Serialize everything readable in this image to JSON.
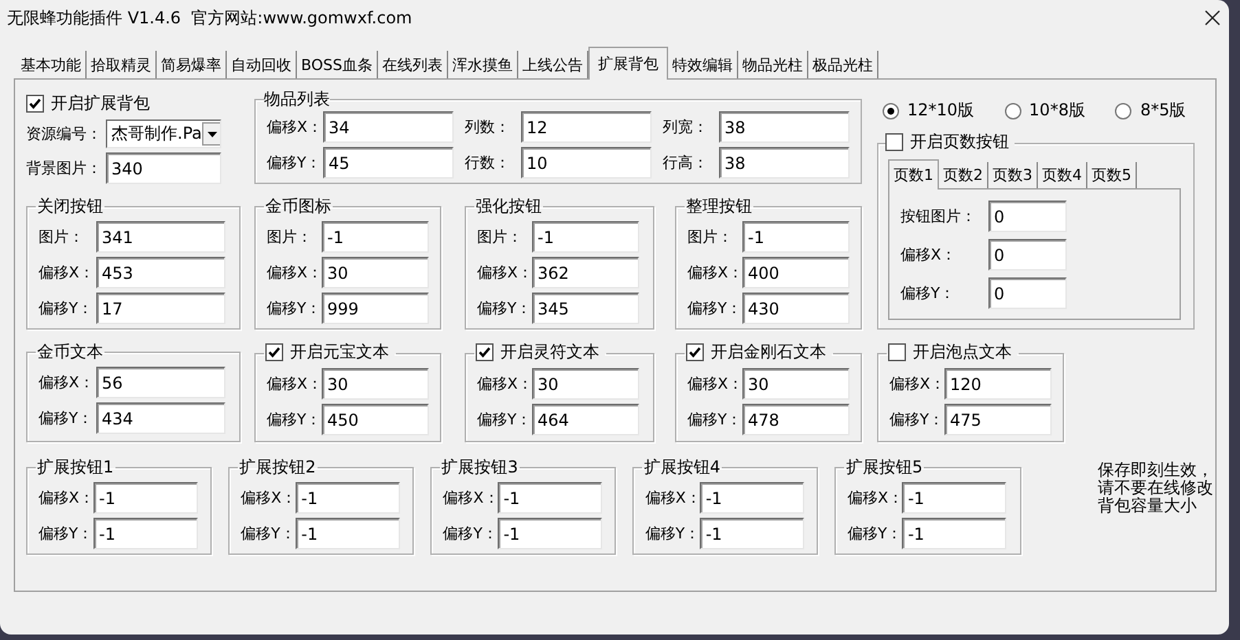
{
  "window": {
    "title": "无限蜂功能插件 V1.4.6  官方网站:www.gomwxf.com"
  },
  "tabs": [
    {
      "label": "基本功能",
      "selected": false
    },
    {
      "label": "拾取精灵",
      "selected": false
    },
    {
      "label": "简易爆率",
      "selected": false
    },
    {
      "label": "自动回收",
      "selected": false
    },
    {
      "label": "BOSS血条",
      "selected": false
    },
    {
      "label": "在线列表",
      "selected": false
    },
    {
      "label": "浑水摸鱼",
      "selected": false
    },
    {
      "label": "上线公告",
      "selected": false
    },
    {
      "label": "扩展背包",
      "selected": true
    },
    {
      "label": "特效编辑",
      "selected": false
    },
    {
      "label": "物品光柱",
      "selected": false
    },
    {
      "label": "极品光柱",
      "selected": false
    }
  ],
  "enable_bag": {
    "label": "开启扩展背包",
    "checked": true
  },
  "resource": {
    "label": "资源编号：",
    "value": "杰哥制作.Pa"
  },
  "background": {
    "label": "背景图片：",
    "value": "340"
  },
  "item_list": {
    "title": "物品列表",
    "fields": [
      {
        "label": "偏移X：",
        "value": "34"
      },
      {
        "label": "列数：",
        "value": "12"
      },
      {
        "label": "列宽：",
        "value": "38"
      },
      {
        "label": "偏移Y：",
        "value": "45"
      },
      {
        "label": "行数：",
        "value": "10"
      },
      {
        "label": "行高：",
        "value": "38"
      }
    ]
  },
  "versions": [
    {
      "label": "12*10版",
      "selected": true
    },
    {
      "label": "10*8版",
      "selected": false
    },
    {
      "label": "8*5版",
      "selected": false
    }
  ],
  "page_buttons": {
    "label": "开启页数按钮",
    "checked": false,
    "tabs": [
      {
        "label": "页数1",
        "selected": true
      },
      {
        "label": "页数2",
        "selected": false
      },
      {
        "label": "页数3",
        "selected": false
      },
      {
        "label": "页数4",
        "selected": false
      },
      {
        "label": "页数5",
        "selected": false
      }
    ],
    "fields": [
      {
        "label": "按钮图片：",
        "value": "0"
      },
      {
        "label": "偏移X：",
        "value": "0"
      },
      {
        "label": "偏移Y：",
        "value": "0"
      }
    ]
  },
  "groups": [
    {
      "kind": "plain",
      "title": "关闭按钮",
      "fields": [
        {
          "label": "图片：",
          "value": "341"
        },
        {
          "label": "偏移X：",
          "value": "453"
        },
        {
          "label": "偏移Y：",
          "value": "17"
        }
      ]
    },
    {
      "kind": "plain",
      "title": "金币图标",
      "fields": [
        {
          "label": "图片：",
          "value": "-1"
        },
        {
          "label": "偏移X：",
          "value": "30"
        },
        {
          "label": "偏移Y：",
          "value": "999"
        }
      ]
    },
    {
      "kind": "plain",
      "title": "强化按钮",
      "fields": [
        {
          "label": "图片：",
          "value": "-1"
        },
        {
          "label": "偏移X：",
          "value": "362"
        },
        {
          "label": "偏移Y：",
          "value": "345"
        }
      ]
    },
    {
      "kind": "plain",
      "title": "整理按钮",
      "fields": [
        {
          "label": "图片：",
          "value": "-1"
        },
        {
          "label": "偏移X：",
          "value": "400"
        },
        {
          "label": "偏移Y：",
          "value": "430"
        }
      ]
    },
    {
      "kind": "plain",
      "title": "金币文本",
      "fields": [
        {
          "label": "偏移X：",
          "value": "56"
        },
        {
          "label": "偏移Y：",
          "value": "434"
        }
      ]
    },
    {
      "kind": "check",
      "title": "开启元宝文本",
      "checked": true,
      "fields": [
        {
          "label": "偏移X：",
          "value": "30"
        },
        {
          "label": "偏移Y：",
          "value": "450"
        }
      ]
    },
    {
      "kind": "check",
      "title": "开启灵符文本",
      "checked": true,
      "fields": [
        {
          "label": "偏移X：",
          "value": "30"
        },
        {
          "label": "偏移Y：",
          "value": "464"
        }
      ]
    },
    {
      "kind": "check",
      "title": "开启金刚石文本",
      "checked": true,
      "fields": [
        {
          "label": "偏移X：",
          "value": "30"
        },
        {
          "label": "偏移Y：",
          "value": "478"
        }
      ]
    },
    {
      "kind": "check",
      "title": "开启泡点文本",
      "checked": false,
      "fields": [
        {
          "label": "偏移X：",
          "value": "120"
        },
        {
          "label": "偏移Y：",
          "value": "475"
        }
      ]
    }
  ],
  "extend_buttons": [
    {
      "title": "扩展按钮1",
      "fields": [
        {
          "label": "偏移X：",
          "value": "-1"
        },
        {
          "label": "偏移Y：",
          "value": "-1"
        }
      ]
    },
    {
      "title": "扩展按钮2",
      "fields": [
        {
          "label": "偏移X：",
          "value": "-1"
        },
        {
          "label": "偏移Y：",
          "value": "-1"
        }
      ]
    },
    {
      "title": "扩展按钮3",
      "fields": [
        {
          "label": "偏移X：",
          "value": "-1"
        },
        {
          "label": "偏移Y：",
          "value": "-1"
        }
      ]
    },
    {
      "title": "扩展按钮4",
      "fields": [
        {
          "label": "偏移X：",
          "value": "-1"
        },
        {
          "label": "偏移Y：",
          "value": "-1"
        }
      ]
    },
    {
      "title": "扩展按钮5",
      "fields": [
        {
          "label": "偏移X：",
          "value": "-1"
        },
        {
          "label": "偏移Y：",
          "value": "-1"
        }
      ]
    }
  ],
  "note": "保存即刻生效，请不要在线修改背包容量大小"
}
